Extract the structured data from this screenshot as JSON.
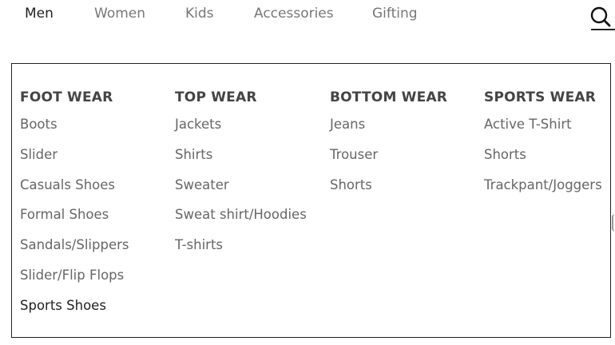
{
  "nav": {
    "items": [
      {
        "label": "Men"
      },
      {
        "label": "Women"
      },
      {
        "label": "Kids"
      },
      {
        "label": "Accessories"
      },
      {
        "label": "Gifting"
      }
    ],
    "search_icon": "search-icon"
  },
  "menu": {
    "columns": [
      {
        "title": "FOOT WEAR",
        "items": [
          "Boots",
          "Slider",
          "Casuals Shoes",
          "Formal Shoes",
          "Sandals/Slippers",
          "Slider/Flip Flops",
          "Sports Shoes"
        ]
      },
      {
        "title": "TOP WEAR",
        "items": [
          "Jackets",
          "Shirts",
          "Sweater",
          "Sweat shirt/Hoodies",
          "T-shirts"
        ]
      },
      {
        "title": "BOTTOM WEAR",
        "items": [
          "Jeans",
          "Trouser",
          "Shorts"
        ]
      },
      {
        "title": "SPORTS WEAR",
        "items": [
          "Active T-Shirt",
          "Shorts",
          "Trackpant/Joggers"
        ]
      }
    ]
  },
  "colors": {
    "text_dark": "#222222",
    "text_muted": "#666666",
    "heading": "#444444",
    "border": "#222222"
  }
}
